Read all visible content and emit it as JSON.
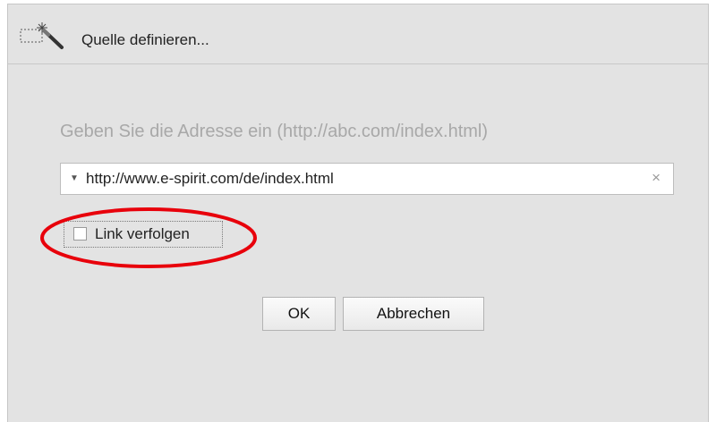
{
  "dialog": {
    "title": "Quelle definieren...",
    "title_icon": "magic-wand-selection-icon"
  },
  "form": {
    "prompt": "Geben Sie die Adresse ein (http://abc.com/index.html)",
    "url_value": "http://www.e-spirit.com/de/index.html",
    "dropdown_icon": "dropdown-arrow-icon",
    "clear_icon": "clear-icon",
    "clear_glyph": "×",
    "checkbox_label": "Link verfolgen",
    "checkbox_checked": false
  },
  "annotation": {
    "highlight_color": "#e8000b"
  },
  "buttons": {
    "ok_label": "OK",
    "cancel_label": "Abbrechen"
  }
}
